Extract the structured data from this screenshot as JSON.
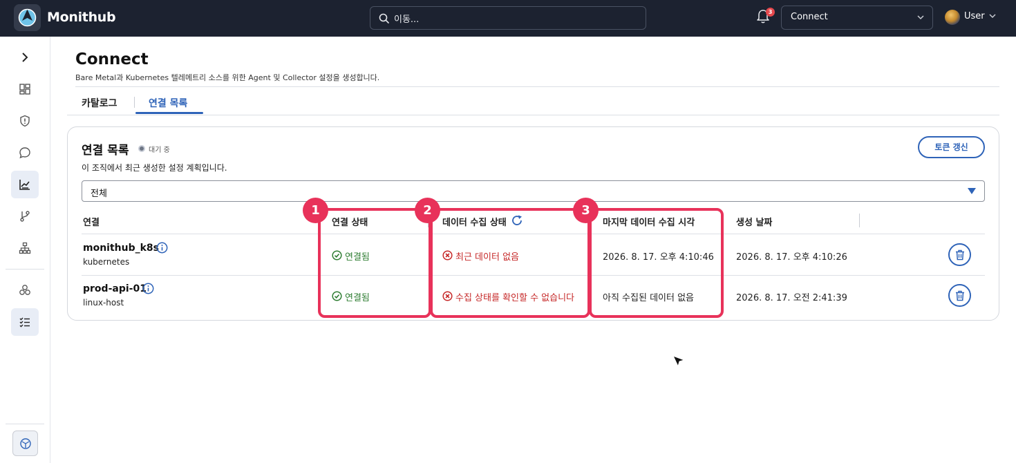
{
  "app": {
    "name": "Monithub"
  },
  "topbar": {
    "search_placeholder": "이동...",
    "notification_count": "3",
    "org_select": "Connect",
    "user_label": "User"
  },
  "page": {
    "title": "Connect",
    "subtitle": "Bare Metal과 Kubernetes 텔레메트리 소스를 위한 Agent 및 Collector 설정을 생성합니다.",
    "tabs": [
      {
        "label": "카탈로그",
        "active": false
      },
      {
        "label": "연결 목록",
        "active": true
      }
    ]
  },
  "card": {
    "title": "연결 목록",
    "status": "대기 중",
    "description": "이 조직에서 최근 생성한 설정 계획입니다.",
    "refresh_label": "토큰 갱신",
    "filter_value": "전체"
  },
  "table": {
    "columns": [
      "연결",
      "연결 상태",
      "데이터 수집 상태",
      "마지막 데이터 수집 시각",
      "생성 날짜"
    ],
    "rows": [
      {
        "name": "monithub_k8s",
        "type": "kubernetes",
        "connection": "연결됨",
        "collection": "최근 데이터 없음",
        "last_collected": "2026. 8. 17. 오후 4:10:46",
        "created": "2026. 8. 17. 오후 4:10:26"
      },
      {
        "name": "prod-api-01",
        "type": "linux-host",
        "connection": "연결됨",
        "collection": "수집 상태를 확인할 수 없습니다",
        "last_collected": "아직 수집된 데이터 없음",
        "created": "2026. 8. 17. 오전 2:41:39"
      }
    ]
  },
  "annotations": {
    "badges": [
      "1",
      "2",
      "3"
    ],
    "color": "#e8325a"
  },
  "colors": {
    "accent": "#2e63b8",
    "success": "#2e7d32",
    "error": "#c62828",
    "topbar": "#1c2230"
  }
}
